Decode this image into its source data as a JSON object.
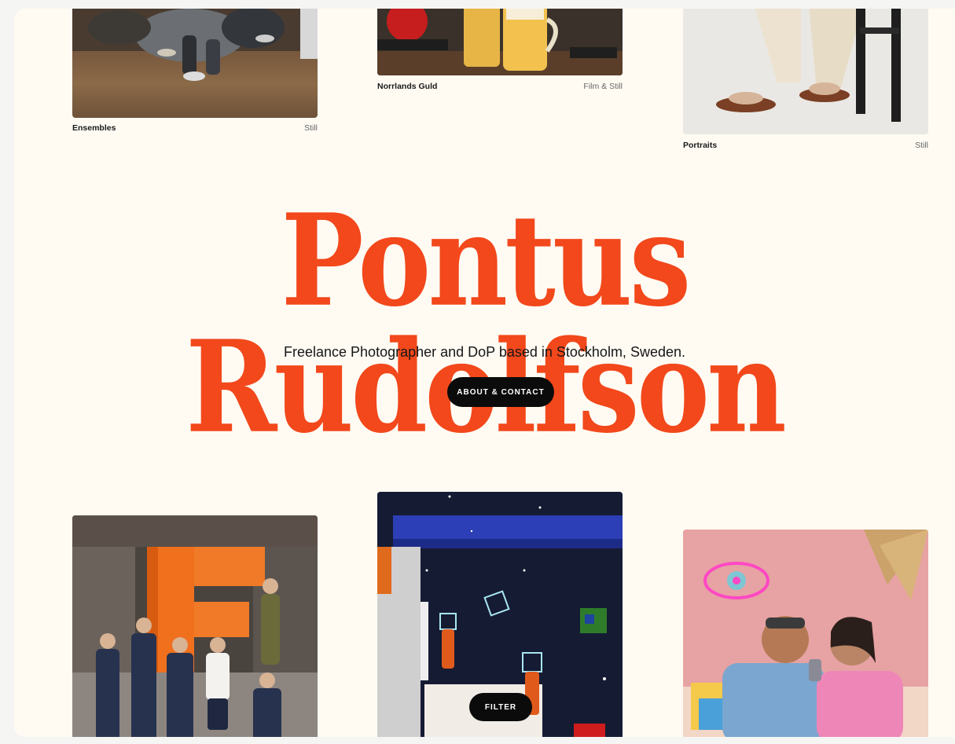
{
  "gallery_top": [
    {
      "title": "Ensembles",
      "category": "Still"
    },
    {
      "title": "Norrlands Guld",
      "category": "Film & Still"
    },
    {
      "title": "Portraits",
      "category": "Still"
    }
  ],
  "hero": {
    "name": "Pontus Rudolfson",
    "tagline": "Freelance Photographer and DoP based in Stockholm, Sweden.",
    "cta_label": "ABOUT & CONTACT"
  },
  "filter_label": "FILTER",
  "colors": {
    "background": "#fffbf3",
    "accent": "#f2481b",
    "button": "#0b0b0b"
  }
}
